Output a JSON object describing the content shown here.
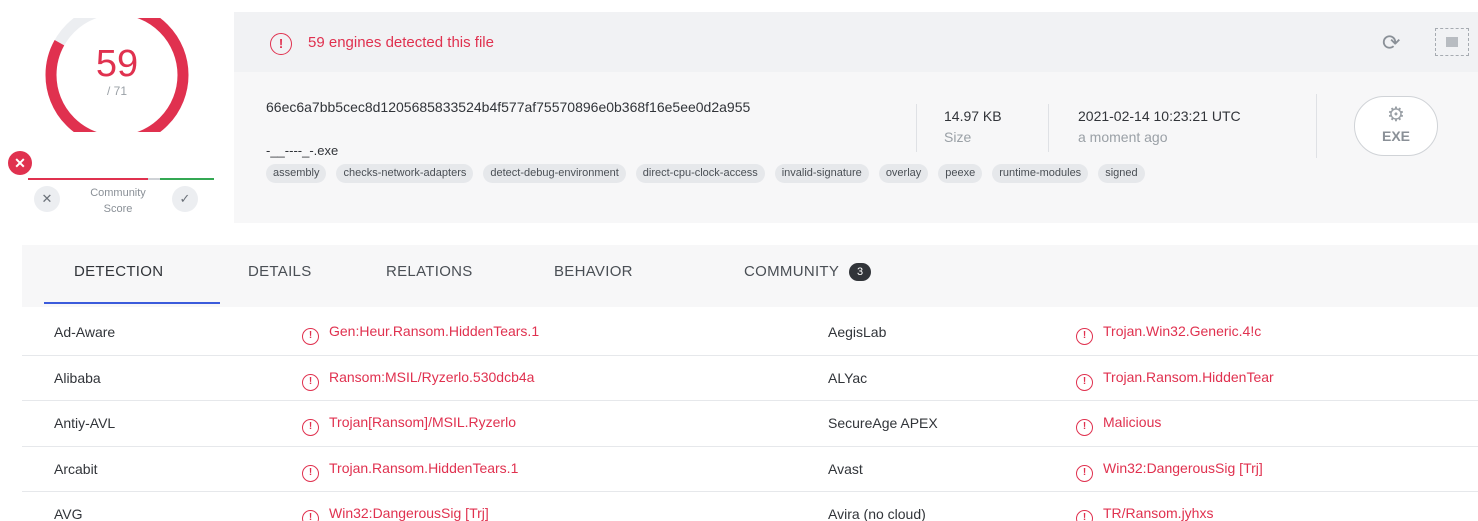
{
  "score": {
    "detected": "59",
    "total": "/ 71",
    "ratio": 0.831,
    "colors": {
      "ring": "#e0314f",
      "ring_bg": "#eceef1"
    }
  },
  "community": {
    "label_line1": "Community",
    "label_line2": "Score",
    "down_icon": "close-icon",
    "up_icon": "check-icon",
    "badge_icon": "close-icon"
  },
  "alert": {
    "text": "59 engines detected this file",
    "icon": "alert-circle-icon"
  },
  "file": {
    "hash": "66ec6a7bb5cec8d1205685833524b4f577af75570896e0b368f16e5ee0d2a955",
    "name": "-__----_-.exe",
    "size_value": "14.97 KB",
    "size_label": "Size",
    "date_value": "2021-02-14 10:23:21 UTC",
    "date_label": "a moment ago",
    "type_label": "EXE",
    "tags": [
      "assembly",
      "checks-network-adapters",
      "detect-debug-environment",
      "direct-cpu-clock-access",
      "invalid-signature",
      "overlay",
      "peexe",
      "runtime-modules",
      "signed"
    ]
  },
  "tabs": [
    {
      "label": "DETECTION"
    },
    {
      "label": "DETAILS"
    },
    {
      "label": "RELATIONS"
    },
    {
      "label": "BEHAVIOR"
    },
    {
      "label": "COMMUNITY",
      "count": "3"
    }
  ],
  "detections": [
    {
      "left_engine": "Ad-Aware",
      "left_result": "Gen:Heur.Ransom.HiddenTears.1",
      "right_engine": "AegisLab",
      "right_result": "Trojan.Win32.Generic.4!c"
    },
    {
      "left_engine": "Alibaba",
      "left_result": "Ransom:MSIL/Ryzerlo.530dcb4a",
      "right_engine": "ALYac",
      "right_result": "Trojan.Ransom.HiddenTear"
    },
    {
      "left_engine": "Antiy-AVL",
      "left_result": "Trojan[Ransom]/MSIL.Ryzerlo",
      "right_engine": "SecureAge APEX",
      "right_result": "Malicious"
    },
    {
      "left_engine": "Arcabit",
      "left_result": "Trojan.Ransom.HiddenTears.1",
      "right_engine": "Avast",
      "right_result": "Win32:DangerousSig [Trj]"
    },
    {
      "left_engine": "AVG",
      "left_result": "Win32:DangerousSig [Trj]",
      "right_engine": "Avira (no cloud)",
      "right_result": "TR/Ransom.jyhxs"
    }
  ]
}
